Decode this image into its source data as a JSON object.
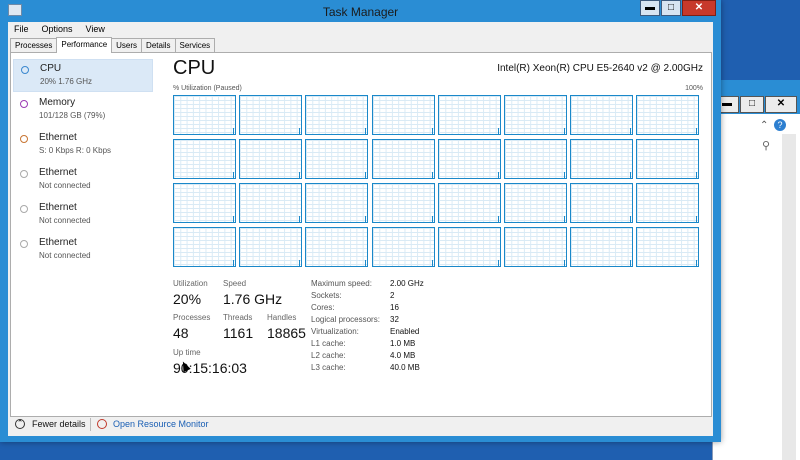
{
  "window": {
    "title": "Task Manager",
    "minimize_glyph": "▬",
    "maximize_glyph": "□",
    "close_glyph": "✕"
  },
  "background_window": {
    "minimize_glyph": "▬",
    "maximize_glyph": "□",
    "close_glyph": "✕",
    "chevron_glyph": "⌃",
    "help_glyph": "?",
    "search_glyph": "⚲"
  },
  "menu": [
    "File",
    "Options",
    "View"
  ],
  "tabs": [
    {
      "label": "Processes",
      "active": false
    },
    {
      "label": "Performance",
      "active": true
    },
    {
      "label": "Users",
      "active": false
    },
    {
      "label": "Details",
      "active": false
    },
    {
      "label": "Services",
      "active": false
    }
  ],
  "sidebar": {
    "items": [
      {
        "title": "CPU",
        "subtitle": "20% 1.76 GHz",
        "icon": "cpu-icon",
        "color": "#3b88cf",
        "selected": true
      },
      {
        "title": "Memory",
        "subtitle": "101/128 GB (79%)",
        "icon": "memory-icon",
        "color": "#9b3cb5",
        "selected": false
      },
      {
        "title": "Ethernet",
        "subtitle": "S: 0 Kbps R: 0 Kbps",
        "icon": "ethernet-icon",
        "color": "#c87533",
        "selected": false
      },
      {
        "title": "Ethernet",
        "subtitle": "Not connected",
        "icon": "ethernet-icon",
        "color": "#aaaaaa",
        "selected": false
      },
      {
        "title": "Ethernet",
        "subtitle": "Not connected",
        "icon": "ethernet-icon",
        "color": "#aaaaaa",
        "selected": false
      },
      {
        "title": "Ethernet",
        "subtitle": "Not connected",
        "icon": "ethernet-icon",
        "color": "#aaaaaa",
        "selected": false
      }
    ]
  },
  "main": {
    "heading": "CPU",
    "cpu_model": "Intel(R) Xeon(R) CPU E5-2640 v2 @ 2.00GHz",
    "graph_label": "% Utilization (Paused)",
    "graph_max": "100%",
    "core_graphs": 32,
    "stats": {
      "utilization_label": "Utilization",
      "utilization_value": "20%",
      "speed_label": "Speed",
      "speed_value": "1.76 GHz",
      "processes_label": "Processes",
      "processes_value": "48",
      "threads_label": "Threads",
      "threads_value": "1161",
      "handles_label": "Handles",
      "handles_value": "18865",
      "uptime_label": "Up time",
      "uptime_value": "90:15:16:03"
    },
    "specs": [
      {
        "label": "Maximum speed:",
        "value": "2.00 GHz"
      },
      {
        "label": "Sockets:",
        "value": "2"
      },
      {
        "label": "Cores:",
        "value": "16"
      },
      {
        "label": "Logical processors:",
        "value": "32"
      },
      {
        "label": "Virtualization:",
        "value": "Enabled"
      },
      {
        "label": "L1 cache:",
        "value": "1.0 MB"
      },
      {
        "label": "L2 cache:",
        "value": "4.0 MB"
      },
      {
        "label": "L3 cache:",
        "value": "40.0 MB"
      }
    ]
  },
  "footer": {
    "fewer_details": "Fewer details",
    "fewer_glyph": "⌃",
    "open_monitor": "Open Resource Monitor"
  },
  "colors": {
    "accent": "#1a88c9",
    "titlebar": "#2a8dd4",
    "link": "#1a5fb4"
  }
}
